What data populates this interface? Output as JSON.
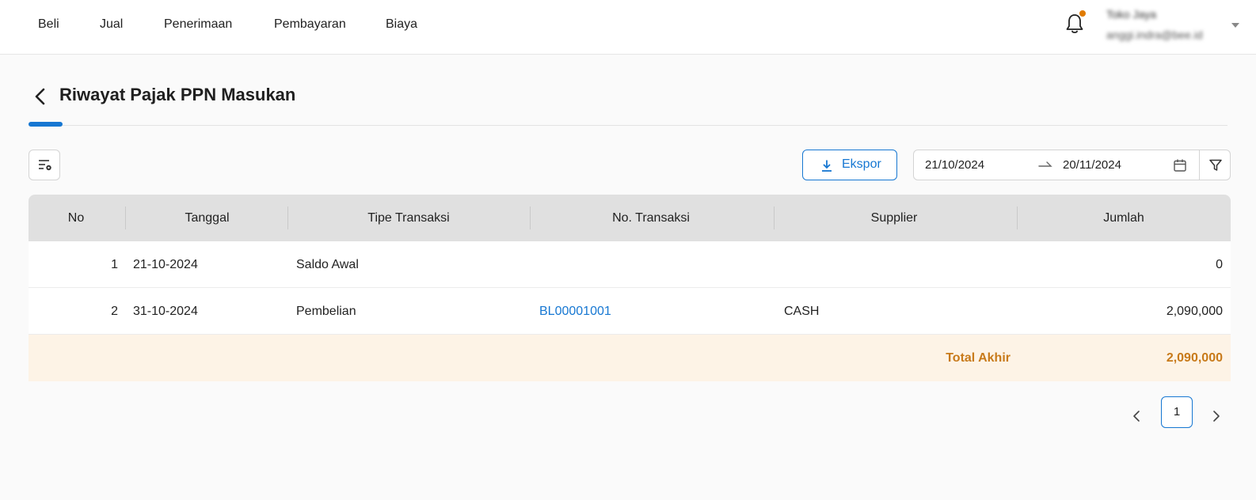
{
  "nav": {
    "items": [
      {
        "label": "Beli"
      },
      {
        "label": "Jual"
      },
      {
        "label": "Penerimaan"
      },
      {
        "label": "Pembayaran"
      },
      {
        "label": "Biaya"
      }
    ]
  },
  "user": {
    "name": "Toko Jaya",
    "email": "anggi.indra@bee.id"
  },
  "page": {
    "title": "Riwayat Pajak PPN Masukan"
  },
  "toolbar": {
    "export_label": "Ekspor",
    "date_start": "21/10/2024",
    "date_end": "20/11/2024"
  },
  "table": {
    "columns": [
      "No",
      "Tanggal",
      "Tipe Transaksi",
      "No. Transaksi",
      "Supplier",
      "Jumlah"
    ],
    "rows": [
      {
        "no": "1",
        "date": "21-10-2024",
        "type": "Saldo Awal",
        "trx": "",
        "supplier": "",
        "amount": "0"
      },
      {
        "no": "2",
        "date": "31-10-2024",
        "type": "Pembelian",
        "trx": "BL00001001",
        "supplier": "CASH",
        "amount": "2,090,000"
      }
    ],
    "total_label": "Total Akhir",
    "total_value": "2,090,000"
  },
  "pagination": {
    "current": "1"
  },
  "colors": {
    "accent": "#1677d2",
    "total": "#c87a1a",
    "notification": "#e07b00"
  }
}
